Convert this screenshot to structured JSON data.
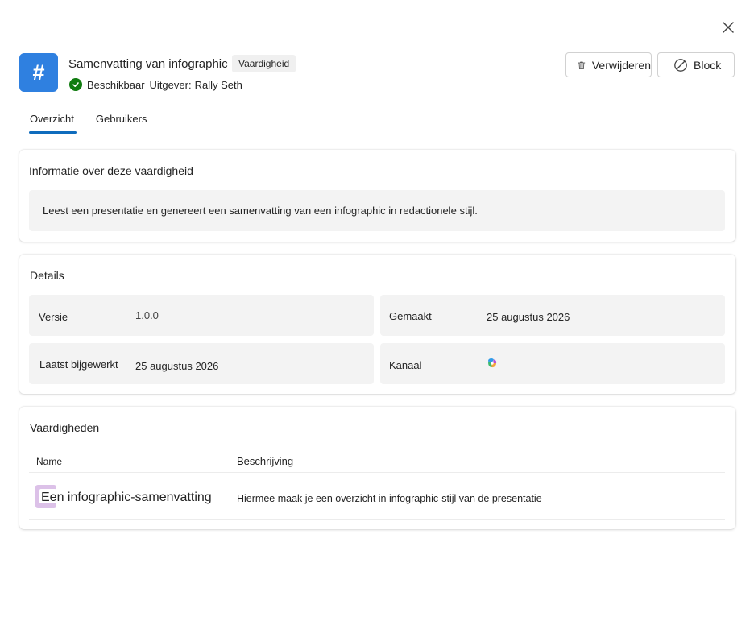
{
  "header": {
    "icon_glyph": "#",
    "title": "Samenvatting van infographic",
    "type_badge": "Vaardigheid",
    "status": "Beschikbaar",
    "publisher_label": "Uitgever:",
    "publisher": "Rally Seth",
    "accent_color": "#2f80e0",
    "status_color": "#107c10"
  },
  "actions": {
    "remove_label": "Verwijderen",
    "block_label": "Block",
    "remove_icon": "trash-icon",
    "block_icon": "block-icon",
    "close_icon": "close-icon"
  },
  "tabs": [
    {
      "label": "Overzicht",
      "active": true
    },
    {
      "label": "Gebruikers",
      "active": false
    }
  ],
  "info": {
    "title": "Informatie over deze vaardigheid",
    "description": "Leest een presentatie en genereert een samenvatting van een infographic in redactionele stijl."
  },
  "details": {
    "title": "Details",
    "version_label": "Versie",
    "version": "1.0.0",
    "created_label": "Gemaakt",
    "created": "25 augustus 2026",
    "updated_label": "Laatst bijgewerkt",
    "updated": "25 augustus 2026",
    "channel_label": "Kanaal",
    "channel_icon": "copilot-icon"
  },
  "skills": {
    "title": "Vaardigheden",
    "col_name": "Name",
    "col_desc": "Beschrijving",
    "rows": [
      {
        "name": "Een infographic-samenvatting",
        "description": "Hiermee maak je een overzicht in infographic-stijl van de presentatie"
      }
    ]
  }
}
